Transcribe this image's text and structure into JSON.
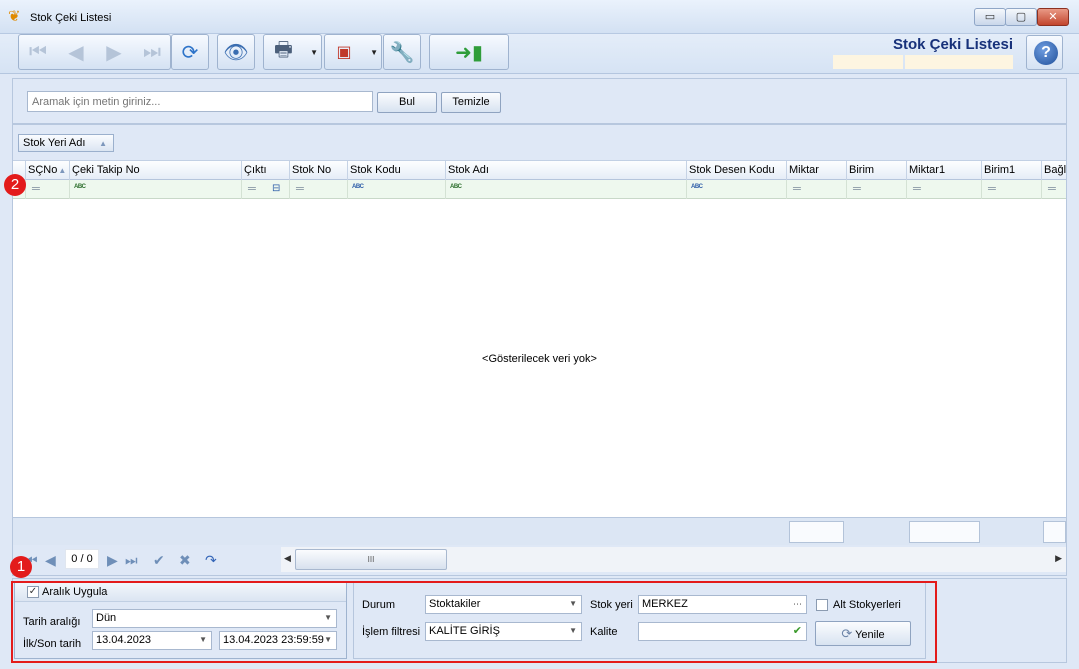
{
  "window": {
    "title": "Stok Çeki Listesi",
    "controls": {
      "minimize": "▭",
      "maximize": "▢",
      "close": "✕"
    }
  },
  "toolbar": {
    "page_title": "Stok Çeki Listesi",
    "icons": [
      "first-record-icon",
      "prev-record-icon",
      "next-record-icon",
      "last-record-icon",
      "refresh-icon",
      "preview-icon",
      "print-icon",
      "export-pdf-icon",
      "tools-icon",
      "exit-icon",
      "help-icon"
    ],
    "help_label": "?"
  },
  "search": {
    "placeholder": "Aramak için metin giriniz...",
    "find_label": "Bul",
    "clear_label": "Temizle"
  },
  "grid": {
    "group_by_label": "Stok Yeri Adı",
    "columns": [
      "SÇNo",
      "Çeki Takip No",
      "Çıktı",
      "Stok No",
      "Stok Kodu",
      "Stok Adı",
      "Stok Desen Kodu",
      "Miktar",
      "Birim",
      "Miktar1",
      "Birim1",
      "Bağlı"
    ],
    "empty_message": "<Gösterilecek veri yok>",
    "filter_abc": "ABC"
  },
  "navigator": {
    "record_count": "0 / 0",
    "scroll_grip": "III"
  },
  "date_range": {
    "apply_label": "Aralık Uygula",
    "apply_checked": true,
    "range_label": "Tarih aralığı",
    "range_value": "Dün",
    "first_last_label": "İlk/Son tarih",
    "start_date": "13.04.2023",
    "end_date": "13.04.2023 23:59:59"
  },
  "filters": {
    "status_label": "Durum",
    "status_value": "Stoktakiler",
    "warehouse_label": "Stok yeri",
    "warehouse_value": "MERKEZ",
    "sub_warehouses_label": "Alt Stokyerleri",
    "operation_filter_label": "İşlem filtresi",
    "operation_filter_value": "KALİTE GİRİŞ",
    "quality_label": "Kalite",
    "quality_value": "",
    "refresh_label": "Yenile"
  },
  "annotations": {
    "badge1": "1",
    "badge2": "2"
  },
  "colors": {
    "highlight": "#e31b1b",
    "title_blue": "#17317a"
  }
}
